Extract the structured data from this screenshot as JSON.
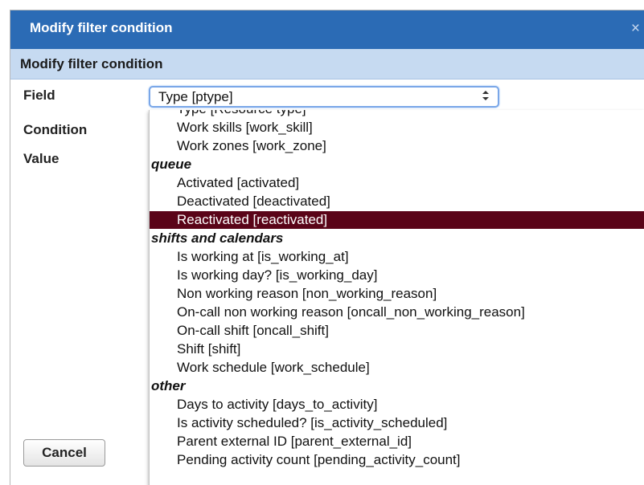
{
  "dialog": {
    "title": "Modify filter condition",
    "close_glyph": "×",
    "subheader": "Modify filter condition"
  },
  "form": {
    "field_label": "Field",
    "condition_label": "Condition",
    "value_label": "Value",
    "field_selected": "Type  [ptype]",
    "select_arrow_glyph": "⇕"
  },
  "dropdown": {
    "options": [
      {
        "kind": "item",
        "text": "Type  [Resource type]"
      },
      {
        "kind": "item",
        "text": "Work skills  [work_skill]"
      },
      {
        "kind": "item",
        "text": "Work zones  [work_zone]"
      },
      {
        "kind": "group",
        "text": "queue"
      },
      {
        "kind": "item",
        "text": "Activated  [activated]"
      },
      {
        "kind": "item",
        "text": "Deactivated  [deactivated]"
      },
      {
        "kind": "item",
        "text": "Reactivated  [reactivated]",
        "selected": true
      },
      {
        "kind": "group",
        "text": "shifts and calendars"
      },
      {
        "kind": "item",
        "text": "Is working at  [is_working_at]"
      },
      {
        "kind": "item",
        "text": "Is working day?  [is_working_day]"
      },
      {
        "kind": "item",
        "text": "Non working reason  [non_working_reason]"
      },
      {
        "kind": "item",
        "text": "On-call non working reason  [oncall_non_working_reason]"
      },
      {
        "kind": "item",
        "text": "On-call shift  [oncall_shift]"
      },
      {
        "kind": "item",
        "text": "Shift  [shift]"
      },
      {
        "kind": "item",
        "text": "Work schedule  [work_schedule]"
      },
      {
        "kind": "group",
        "text": "other"
      },
      {
        "kind": "item",
        "text": "Days to activity  [days_to_activity]"
      },
      {
        "kind": "item",
        "text": "Is activity scheduled?  [is_activity_scheduled]"
      },
      {
        "kind": "item",
        "text": "Parent external ID  [parent_external_id]"
      },
      {
        "kind": "item",
        "text": "Pending activity count  [pending_activity_count]"
      }
    ]
  },
  "buttons": {
    "cancel_label": "Cancel"
  },
  "colors": {
    "titlebar": "#2b6bb5",
    "subheader": "#c6daf1",
    "selected_option": "#5a0418"
  }
}
